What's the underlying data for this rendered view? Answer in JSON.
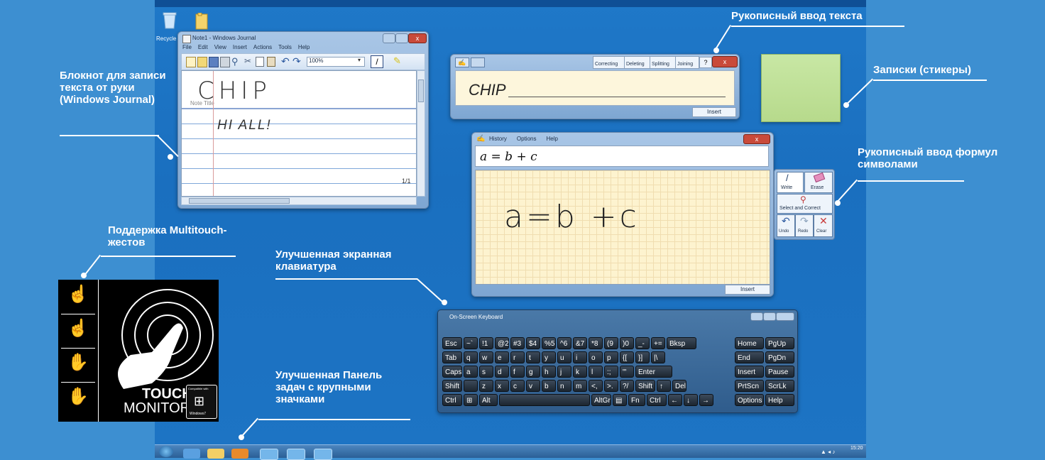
{
  "callouts": {
    "journal": "Блокнот для записи текста от руки (Windows Journal)",
    "text_input": "Рукописный ввод текста",
    "stickers": "Записки (стикеры)",
    "math_input": "Рукописный ввод формул символами",
    "multitouch": "Поддержка Multitouch-жестов",
    "osk": "Улучшенная экранная клавиатура",
    "taskbar": "Улучшенная Панель задач с крупными значками"
  },
  "desktop": {
    "recycle_label": "Recycle"
  },
  "journal": {
    "title": "Note1 - Windows Journal",
    "menu": [
      "File",
      "Edit",
      "View",
      "Insert",
      "Actions",
      "Tools",
      "Help"
    ],
    "zoom": "100%",
    "note_title_label": "Note Title",
    "handwritten_title": "CHIP",
    "handwritten_body": "HI ALL!",
    "page_indicator": "1/1"
  },
  "tip": {
    "buttons": [
      "Correcting",
      "Deleting",
      "Splitting",
      "Joining"
    ],
    "recognized_text": "CHIP",
    "insert_label": "Insert"
  },
  "math": {
    "menu": [
      "History",
      "Options",
      "Help"
    ],
    "preview": "a = b + c",
    "handwritten": "a=b +c",
    "tools": {
      "write": "Write",
      "erase": "Erase",
      "select": "Select and Correct",
      "undo": "Undo",
      "redo": "Redo",
      "clear": "Clear"
    },
    "insert_label": "Insert"
  },
  "touch_logo": {
    "line1": "TOUCH",
    "line2": "MONITOR",
    "compatible": "Compatible with",
    "windows": "Windows7"
  },
  "osk": {
    "title": "On-Screen Keyboard",
    "rows": [
      [
        "Esc",
        "~`",
        "!1",
        "@2",
        "#3",
        "$4",
        "%5",
        "^6",
        "&7",
        "*8",
        "(9",
        ")0",
        "_-",
        "+=",
        "Bksp"
      ],
      [
        "Tab",
        "q",
        "w",
        "e",
        "r",
        "t",
        "y",
        "u",
        "i",
        "o",
        "p",
        "{[",
        "}]",
        "|\\"
      ],
      [
        "Caps",
        "a",
        "s",
        "d",
        "f",
        "g",
        "h",
        "j",
        "k",
        "l",
        ":;",
        "\"'",
        "Enter"
      ],
      [
        "Shift",
        "",
        "z",
        "x",
        "c",
        "v",
        "b",
        "n",
        "m",
        "<,",
        ">.",
        "?/",
        "Shift",
        "↑",
        "Del"
      ],
      [
        "Ctrl",
        "⊞",
        "Alt",
        "",
        "AltGr",
        "▤",
        "Fn",
        "Ctrl",
        "←",
        "↓",
        "→"
      ]
    ],
    "right_rows": [
      [
        "Home",
        "PgUp"
      ],
      [
        "End",
        "PgDn"
      ],
      [
        "Insert",
        "Pause"
      ],
      [
        "PrtScn",
        "ScrLk"
      ],
      [
        "Options",
        "Help"
      ]
    ]
  },
  "taskbar": {
    "clock": "15:20"
  }
}
